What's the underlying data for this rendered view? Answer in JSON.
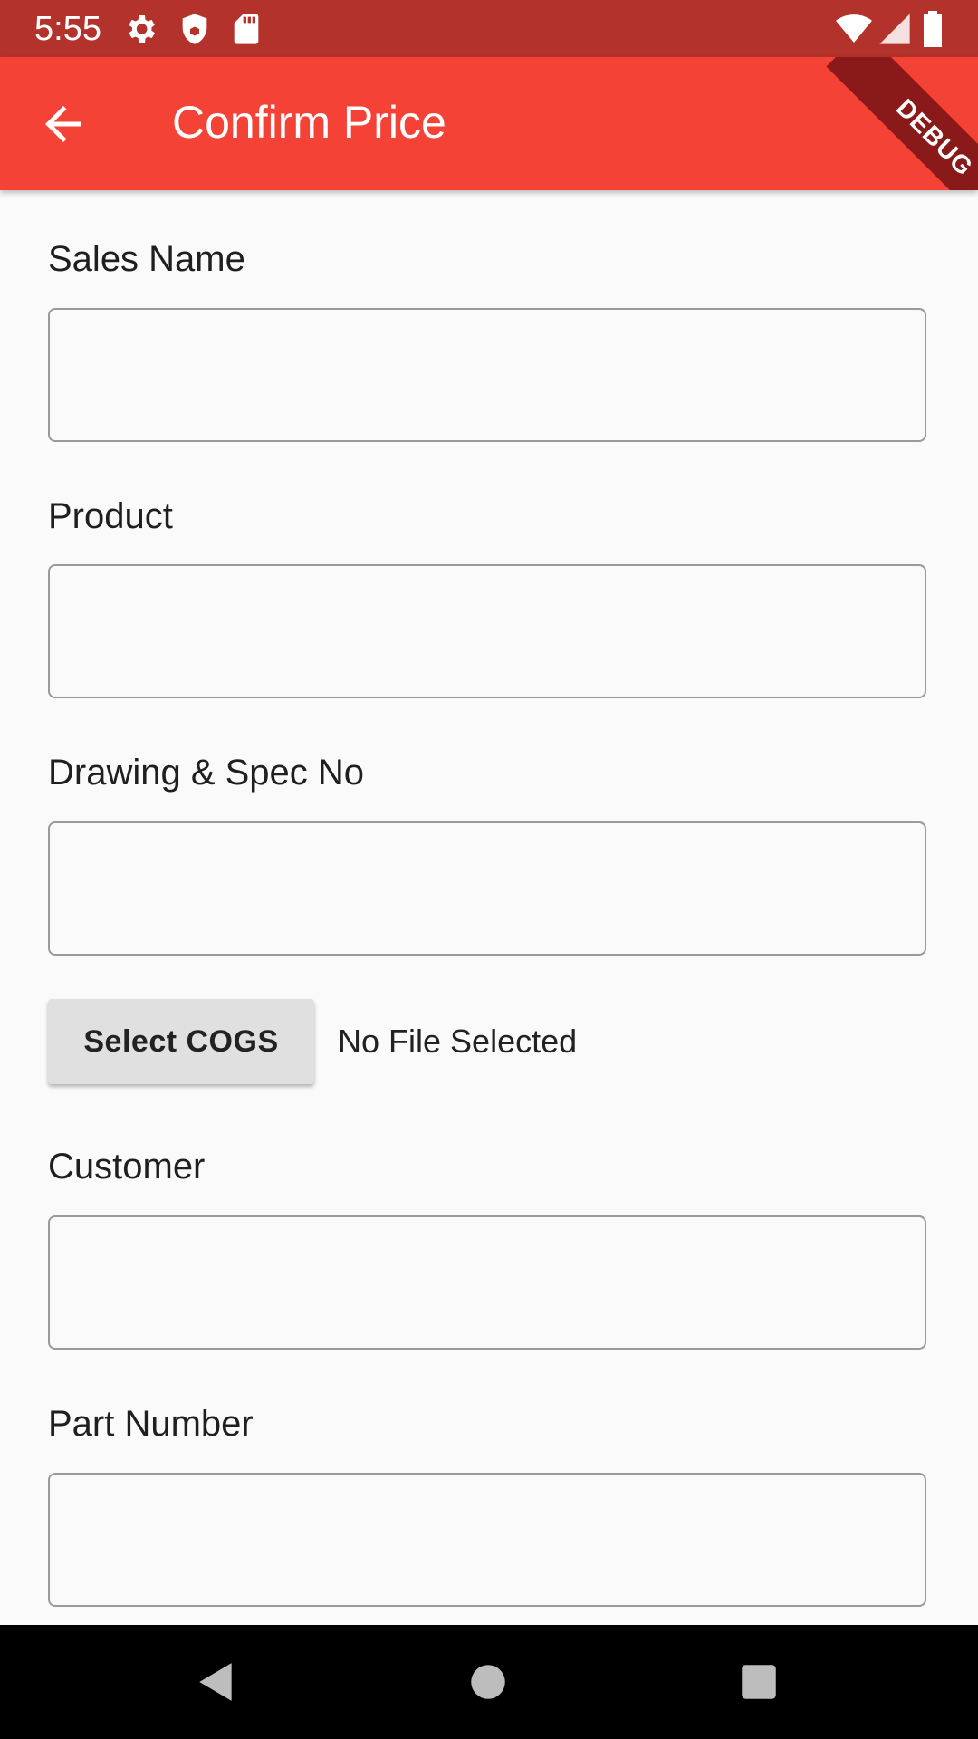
{
  "status_bar": {
    "time": "5:55",
    "icons_left": [
      "settings-icon",
      "shield-icon",
      "sd-card-icon"
    ],
    "icons_right": [
      "wifi-icon",
      "signal-icon",
      "battery-icon"
    ],
    "background": "#b3322b"
  },
  "app_bar": {
    "title": "Confirm Price",
    "back_icon": "arrow-back-icon",
    "background": "#f44336",
    "debug_banner": "DEBUG"
  },
  "form": {
    "fields": [
      {
        "label": "Sales Name",
        "value": ""
      },
      {
        "label": "Product",
        "value": ""
      },
      {
        "label": "Drawing & Spec No",
        "value": ""
      },
      {
        "label": "Customer",
        "value": ""
      },
      {
        "label": "Part Number",
        "value": ""
      }
    ],
    "file_picker": {
      "button_label": "Select COGS",
      "status": "No File Selected"
    }
  },
  "nav_bar": {
    "buttons": [
      "back-triangle-icon",
      "home-circle-icon",
      "recents-square-icon"
    ]
  }
}
